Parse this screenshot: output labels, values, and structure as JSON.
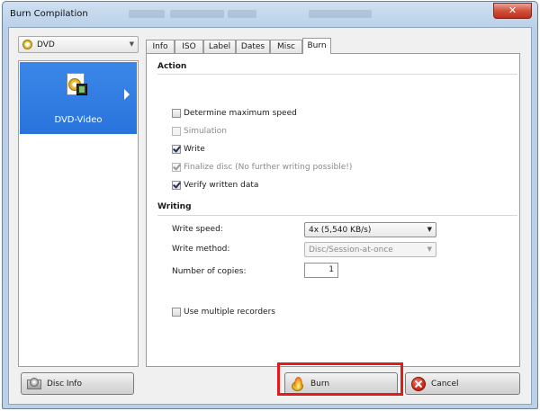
{
  "window": {
    "title": "Burn Compilation",
    "close_glyph": "✕"
  },
  "recorder_combo": {
    "value": "DVD",
    "icon": "disc-icon"
  },
  "project_list": {
    "items": [
      {
        "label": "DVD-Video",
        "selected": true,
        "icon": "dvd-video-icon"
      }
    ]
  },
  "tabs": [
    {
      "label": "Info",
      "active": false
    },
    {
      "label": "ISO",
      "active": false
    },
    {
      "label": "Label",
      "active": false
    },
    {
      "label": "Dates",
      "active": false
    },
    {
      "label": "Misc",
      "active": false
    },
    {
      "label": "Burn",
      "active": true
    }
  ],
  "action": {
    "heading": "Action",
    "options": [
      {
        "label": "Determine maximum speed",
        "checked": false,
        "enabled": true
      },
      {
        "label": "Simulation",
        "checked": false,
        "enabled": false
      },
      {
        "label": "Write",
        "checked": true,
        "enabled": true
      },
      {
        "label": "Finalize disc (No further writing possible!)",
        "checked": true,
        "enabled": false
      },
      {
        "label": "Verify written data",
        "checked": true,
        "enabled": true
      }
    ]
  },
  "writing": {
    "heading": "Writing",
    "write_speed": {
      "label": "Write speed:",
      "value": "4x (5,540 KB/s)"
    },
    "write_method": {
      "label": "Write method:",
      "value": "Disc/Session-at-once",
      "enabled": false
    },
    "copies": {
      "label": "Number of copies:",
      "value": "1"
    },
    "multiple_recorders": {
      "label": "Use multiple recorders",
      "checked": false
    }
  },
  "buttons": {
    "disc_info": "Disc Info",
    "burn": "Burn",
    "cancel": "Cancel"
  },
  "colors": {
    "selection_blue": "#2b78df",
    "highlight_red": "#e01b1b",
    "close_red": "#c8402c"
  }
}
